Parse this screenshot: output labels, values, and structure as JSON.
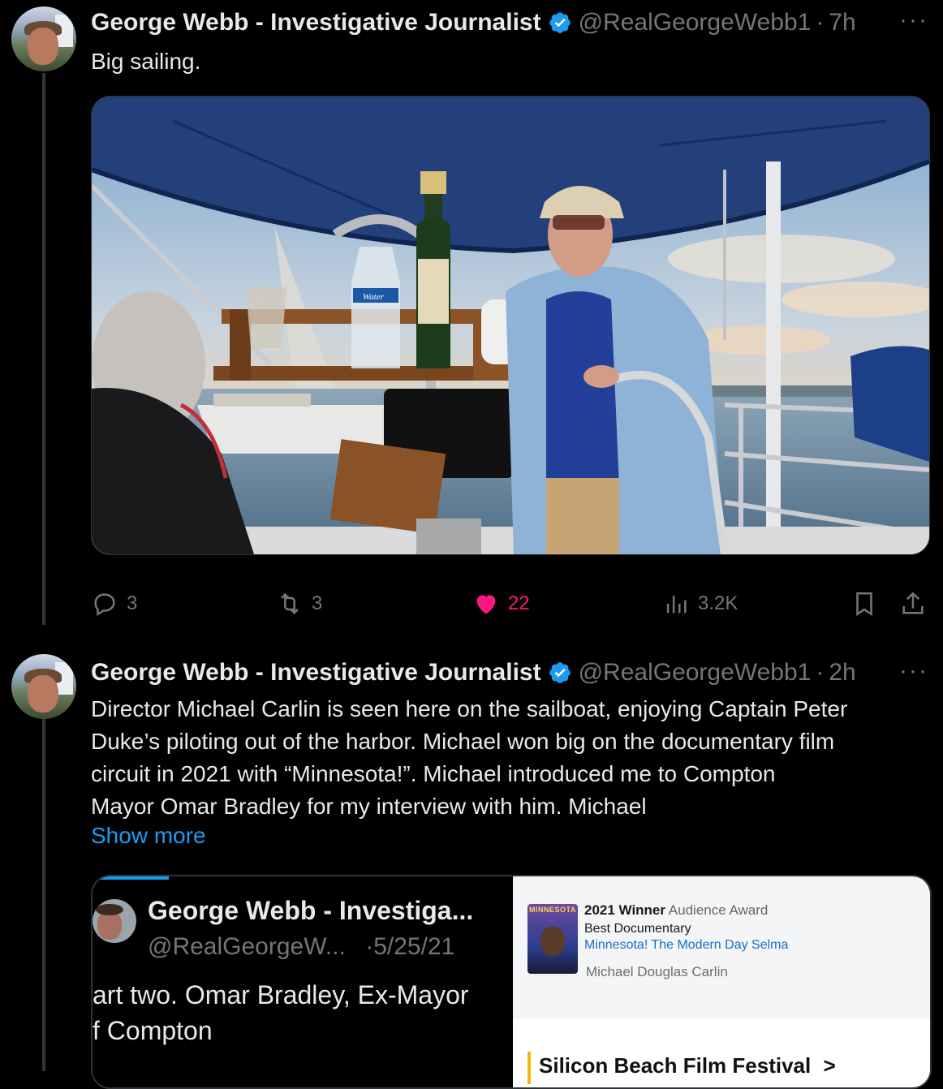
{
  "tweets": [
    {
      "author_name": "George Webb - Investigative Journalist",
      "handle": "@RealGeorgeWebb1",
      "dot": "·",
      "time": "7h",
      "text": "Big sailing.",
      "more_label": "···",
      "actions": {
        "replies": "3",
        "retweets": "3",
        "likes": "22",
        "views": "3.2K"
      }
    },
    {
      "author_name": "George Webb - Investigative Journalist",
      "handle": "@RealGeorgeWebb1",
      "dot": "·",
      "time": "2h",
      "more_label": "···",
      "text_lines": [
        "Director Michael Carlin is seen here on the sailboat, enjoying Captain Peter",
        "Duke’s piloting out of the harbor. Michael won big on the documentary film",
        "circuit in 2021 with “Minnesota!”.   Michael introduced me to Compton",
        "Mayor Omar Bradley for my interview with him.  Michael"
      ],
      "show_more": "Show more"
    }
  ],
  "photo_labels": {
    "water_bottle": "Water"
  },
  "quote": {
    "left": {
      "name": "George Webb - Investiga...",
      "handle": "@RealGeorgeW...",
      "date": "·5/25/21",
      "text_line1": "art two. Omar Bradley, Ex-Mayor",
      "text_line2": "f Compton"
    },
    "right": {
      "poster_title": "MINNESOTA",
      "winner_year": "2021 Winner",
      "award": "Audience Award",
      "category": "Best Documentary",
      "film": "Minnesota! The Modern Day Selma",
      "director": "Michael Douglas Carlin",
      "festival": "Silicon Beach Film Festival",
      "festival_chevron": ">"
    }
  },
  "colors": {
    "accent": "#1d9bf0",
    "like": "#f91880",
    "muted": "#71767b"
  },
  "icons": [
    "verified-badge-icon",
    "reply-icon",
    "retweet-icon",
    "heart-icon",
    "views-icon",
    "bookmark-icon",
    "share-icon",
    "more-icon"
  ]
}
